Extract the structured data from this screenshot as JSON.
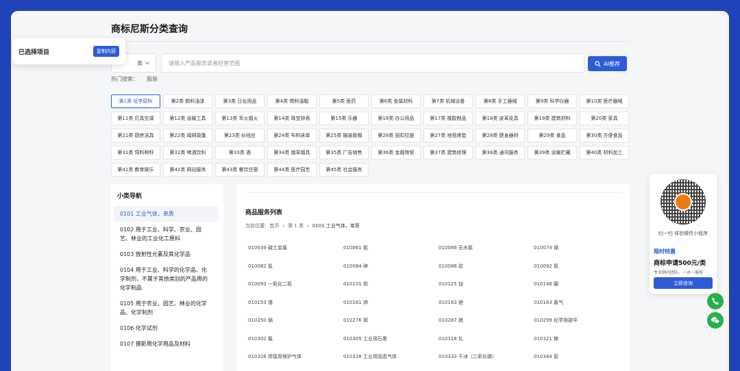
{
  "page": {
    "title": "商标尼斯分类查询"
  },
  "selected_panel": {
    "label": "已选择项目",
    "copy_button": "复制内容"
  },
  "search": {
    "category_value": "类",
    "placeholder": "请输入产品服务或者经营范围",
    "ai_button": "AI推荐",
    "hot_label": "热门搜索：",
    "hot_terms": [
      "服装"
    ]
  },
  "classes": [
    "第1类 化学原料",
    "第2类 颜料油漆",
    "第3类 日化用品",
    "第4类 燃料油脂",
    "第5类 医药",
    "第6类 金属材料",
    "第7类 机械设备",
    "第8类 手工器械",
    "第9类 科学仪器",
    "第10类 医疗器械",
    "第11类 灯具空调",
    "第12类 运输工具",
    "第13类 军火烟火",
    "第14类 珠宝钟表",
    "第15类 乐器",
    "第16类 办公用品",
    "第17类 橡胶制品",
    "第18类 皮革皮具",
    "第19类 建筑材料",
    "第20类 家具",
    "第21类 厨房洁具",
    "第22类 绳网袋篷",
    "第23类 纱线丝",
    "第24类 布料床单",
    "第25类 服装鞋帽",
    "第26类 钮扣拉链",
    "第27类 地毯席垫",
    "第28类 健身器材",
    "第29类 食品",
    "第30类 方便食品",
    "第31类 饲料种籽",
    "第32类 啤酒饮料",
    "第33类 酒",
    "第34类 烟草烟具",
    "第35类 广告销售",
    "第36类 金融物管",
    "第37类 建筑修理",
    "第38类 通讯服务",
    "第39类 运输贮藏",
    "第40类 材料加工",
    "第41类 教育娱乐",
    "第42类 网站服务",
    "第43类 餐饮住宿",
    "第44类 医疗园艺",
    "第45类 社会服务"
  ],
  "subnav": {
    "title": "小类导航",
    "items": [
      "0101 工业气体，单质",
      "0102 用于工业、科学、农业、园艺、林业的工业化工原料",
      "0103 放射性元素及其化学品",
      "0104 用于工业、科学的化学品、化学制剂，不属于其他类别的产品用的化学制品",
      "0105 用于农业、园艺、林业的化学品、化学制剂",
      "0106 化学试剂",
      "0107 摄影用化学用品及材料"
    ]
  },
  "goods": {
    "title": "商品服务列表",
    "breadcrumb": {
      "label": "当前位置:",
      "home": "首页",
      "level1": "第 1 类",
      "current": "0101 工业气体，单质"
    },
    "items": [
      "010039 碱土金属",
      "010061 氨",
      "010066 无水氨",
      "010074 锑",
      "010082 氩",
      "010084 砷",
      "010086 砹",
      "010092 氮",
      "010093 一氧化二氮",
      "010101 钡",
      "010125 铋",
      "010148 硼",
      "010153 镨",
      "010161 铈",
      "010163 铯",
      "010183 氯气",
      "010250 镝",
      "010276 铒",
      "010287 铕",
      "010299 化学用硫华",
      "010302 氟",
      "010305 工业用石墨",
      "010318 钆",
      "010321 镓",
      "010326 焊接用保护气体",
      "010328 工业用固态气体",
      "010333 干冰（二氧化碳）",
      "010344 氦"
    ]
  },
  "qr_card": {
    "caption": "扫一扫 体验微信小程序",
    "promo_title": "限时特惠",
    "promo_main": "商标申请500元/类",
    "promo_sub": "专业顾问团队，一对一服务",
    "button": "立即咨询"
  },
  "colors": {
    "accent": "#2e5bd8",
    "frame": "#1f43b8",
    "fab": "#25b04b"
  }
}
